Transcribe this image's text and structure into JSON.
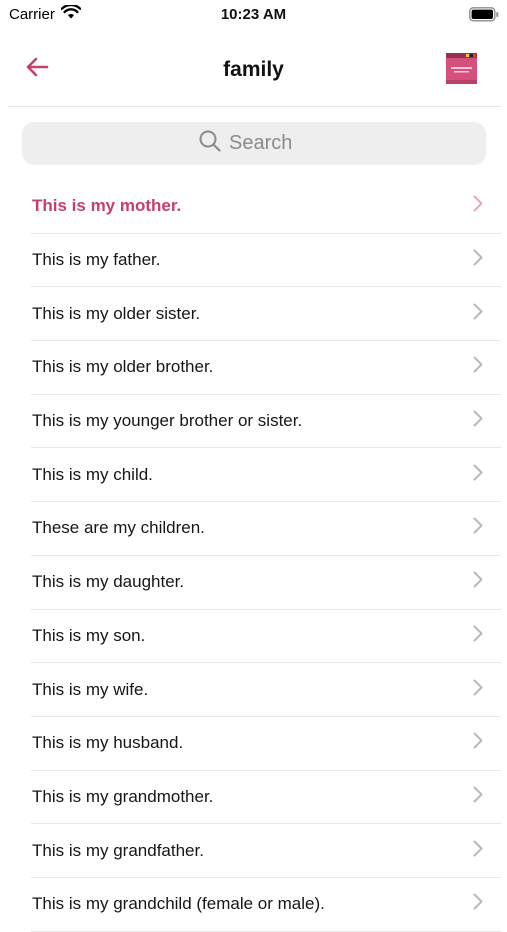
{
  "status": {
    "carrier": "Carrier",
    "time": "10:23 AM"
  },
  "nav": {
    "title": "family",
    "back_icon": "arrow-left-icon",
    "book_icon": "book-cover-icon"
  },
  "search": {
    "placeholder": "Search"
  },
  "colors": {
    "accent": "#c5406e",
    "chevron": "#b8b8bc",
    "chevron_active": "#e8a6bd"
  },
  "phrases": [
    {
      "label": "This is my mother.",
      "active": true
    },
    {
      "label": "This is my father."
    },
    {
      "label": "This is my older sister."
    },
    {
      "label": "This is my older brother."
    },
    {
      "label": "This is my younger brother or sister."
    },
    {
      "label": "This is my child."
    },
    {
      "label": "These are my children."
    },
    {
      "label": "This is my daughter."
    },
    {
      "label": "This is my son."
    },
    {
      "label": "This is my wife."
    },
    {
      "label": "This is my husband."
    },
    {
      "label": "This is my grandmother."
    },
    {
      "label": "This is my grandfather."
    },
    {
      "label": "This is my grandchild (female or male)."
    }
  ]
}
